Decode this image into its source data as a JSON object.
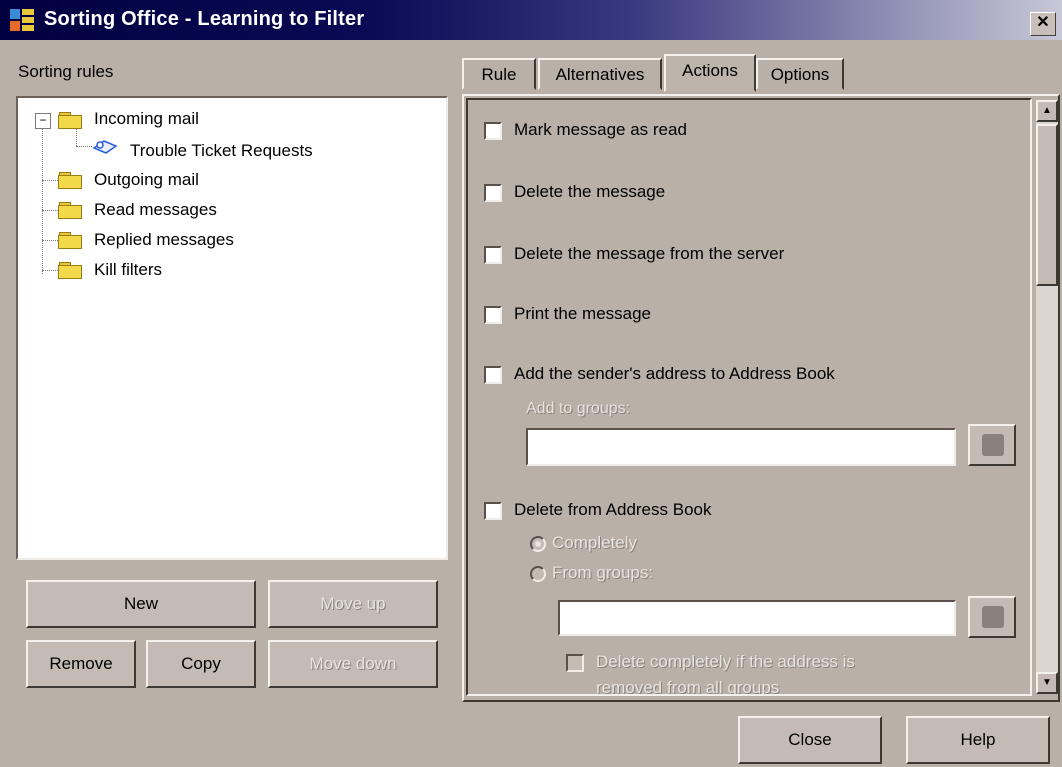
{
  "window": {
    "title": "Sorting Office - Learning to Filter",
    "close_glyph": "✕"
  },
  "left": {
    "label": "Sorting rules",
    "tree": [
      {
        "label": "Incoming mail",
        "expander": "⊟"
      },
      {
        "label": "Trouble Ticket Requests"
      },
      {
        "label": "Outgoing mail"
      },
      {
        "label": "Read messages"
      },
      {
        "label": "Replied messages"
      },
      {
        "label": "Kill filters"
      }
    ],
    "buttons": {
      "new": "New",
      "move_up": "Move up",
      "remove": "Remove",
      "copy": "Copy",
      "move_down": "Move down"
    }
  },
  "tabs": [
    "Rule",
    "Alternatives",
    "Actions",
    "Options"
  ],
  "active_tab": "Actions",
  "actions": {
    "mark_read": "Mark message as read",
    "delete_message": "Delete the message",
    "delete_server": "Delete the message from the server",
    "print_message": "Print the message",
    "add_sender": "Add the sender's address to Address Book",
    "add_to_groups_label": "Add to groups:",
    "delete_from_book": "Delete from Address Book",
    "completely": "Completely",
    "from_groups": "From groups:",
    "delete_completely_line1": "Delete completely if the address is",
    "delete_completely_line2": "removed from all groups"
  },
  "footer": {
    "close": "Close",
    "help": "Help"
  }
}
